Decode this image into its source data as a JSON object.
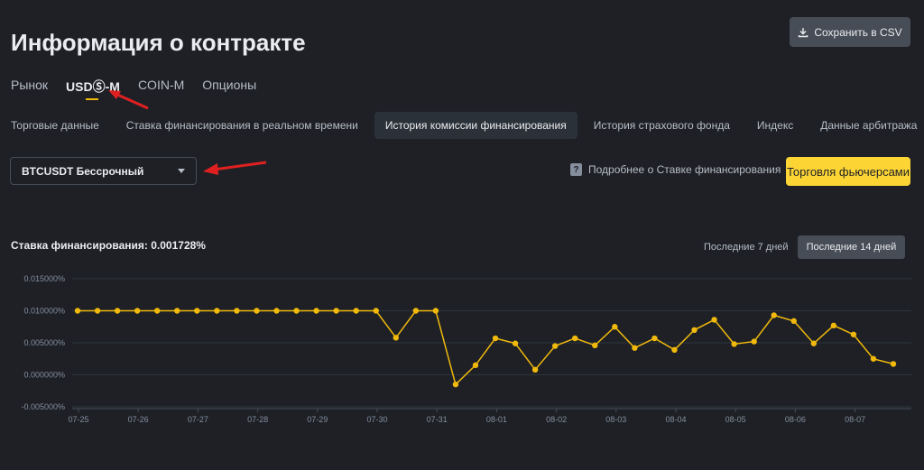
{
  "header": {
    "title": "Информация о контракте",
    "csv_button": "Сохранить в CSV"
  },
  "market_tabs": [
    {
      "label": "Рынок",
      "active": false
    },
    {
      "label": "USDⓈ-M",
      "active": true
    },
    {
      "label": "COIN-M",
      "active": false
    },
    {
      "label": "Опционы",
      "active": false
    }
  ],
  "sub_tabs": [
    {
      "label": "Торговые данные",
      "active": false
    },
    {
      "label": "Ставка финансирования в реальном времени",
      "active": false
    },
    {
      "label": "История комиссии финансирования",
      "active": true
    },
    {
      "label": "История страхового фонда",
      "active": false
    },
    {
      "label": "Индекс",
      "active": false
    },
    {
      "label": "Данные арбитража",
      "active": false
    }
  ],
  "symbol_select": {
    "value": "BTCUSDT Бессрочный"
  },
  "more_link": "Подробнее о Ставке финансирования",
  "trade_button": "Торговля фьючерсами",
  "rate": {
    "label": "Ставка финансирования:",
    "value": "0.001728%"
  },
  "range_buttons": [
    {
      "label": "Последние 7 дней",
      "active": false
    },
    {
      "label": "Последние 14 дней",
      "active": true
    }
  ],
  "colors": {
    "accent": "#fcd535",
    "line": "#f0b90b",
    "annotation_arrow": "#e02020"
  },
  "chart_data": {
    "type": "line",
    "ylim": [
      -0.005,
      0.015
    ],
    "yticks": [
      "-0.005000%",
      "0.000000%",
      "0.005000%",
      "0.010000%",
      "0.015000%"
    ],
    "ytick_values": [
      -0.005,
      0.0,
      0.005,
      0.01,
      0.015
    ],
    "xticks": [
      "07-25",
      "07-26",
      "07-27",
      "07-28",
      "07-29",
      "07-30",
      "07-31",
      "08-01",
      "08-02",
      "08-03",
      "08-04",
      "08-05",
      "08-06",
      "08-07"
    ],
    "grid": true,
    "series": [
      {
        "values": [
          0.01,
          0.01,
          0.01,
          0.01,
          0.01,
          0.01,
          0.01,
          0.01,
          0.01,
          0.01,
          0.01,
          0.01,
          0.01,
          0.01,
          0.01,
          0.01,
          0.0058,
          0.01,
          0.01,
          -0.0015,
          0.0015,
          0.0057,
          0.0049,
          0.0008,
          0.0045,
          0.0057,
          0.0046,
          0.0075,
          0.0042,
          0.0057,
          0.0039,
          0.007,
          0.0086,
          0.0048,
          0.0052,
          0.0093,
          0.0084,
          0.0049,
          0.0077,
          0.0063,
          0.0025,
          0.0017
        ]
      }
    ]
  }
}
